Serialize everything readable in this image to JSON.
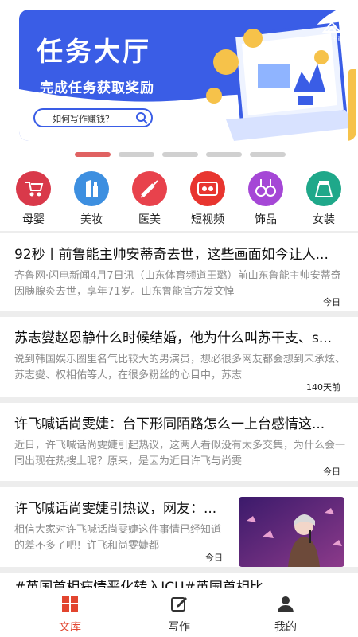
{
  "banner": {
    "title": "任务大厅",
    "subtitle": "完成任务获取奖励",
    "search_text": "如何写作赚钱？",
    "logo_text": "新新生意",
    "dot_count": 5,
    "active_dot": 0
  },
  "categories": [
    {
      "label": "母婴",
      "icon": "stroller-icon",
      "color": "#d9394a"
    },
    {
      "label": "美妆",
      "icon": "lipstick-icon",
      "color": "#3d8fe0"
    },
    {
      "label": "医美",
      "icon": "syringe-icon",
      "color": "#e8424c"
    },
    {
      "label": "短视频",
      "icon": "video-tape-icon",
      "color": "#e8352f"
    },
    {
      "label": "饰品",
      "icon": "earrings-icon",
      "color": "#a547d6"
    },
    {
      "label": "女装",
      "icon": "skirt-icon",
      "color": "#1fa88a"
    }
  ],
  "articles": [
    {
      "title": "92秒丨前鲁能主帅安蒂奇去世，这些画面如今让人...",
      "body": "齐鲁网·闪电新闻4月7日讯（山东体育频道王璐）前山东鲁能主帅安蒂奇因胰腺炎去世，享年71岁。山东鲁能官方发文悼",
      "time": "今日"
    },
    {
      "title": "苏志燮赵恩静什么时候结婚，他为什么叫苏干支、s...",
      "body": "说到韩国娱乐圈里名气比较大的男演员，想必很多网友都会想到宋承炫、苏志燮、权相佑等人，在很多粉丝的心目中，苏志",
      "time": "140天前"
    },
    {
      "title": "许飞喊话尚雯婕：台下形同陌路怎么一上台感情这...",
      "body": "近日，许飞喊话尚雯婕引起热议，这两人看似没有太多交集，为什么会一同出现在热搜上呢？原来，是因为近日许飞与尚雯",
      "time": "今日"
    },
    {
      "title": "许飞喊话尚雯婕引热议，网友：...",
      "body": "相信大家对许飞喊话尚雯婕这件事情已经知道的差不多了吧！许飞和尚雯婕都",
      "time": "今日"
    },
    {
      "title": "#英国首相病情恶化转入ICU#英国首相比..."
    }
  ],
  "tabs": [
    {
      "label": "文库",
      "icon": "grid-icon"
    },
    {
      "label": "写作",
      "icon": "edit-icon"
    },
    {
      "label": "我的",
      "icon": "user-icon"
    }
  ],
  "colors": {
    "accent": "#e2452f",
    "banner_blue": "#3a5de6"
  }
}
